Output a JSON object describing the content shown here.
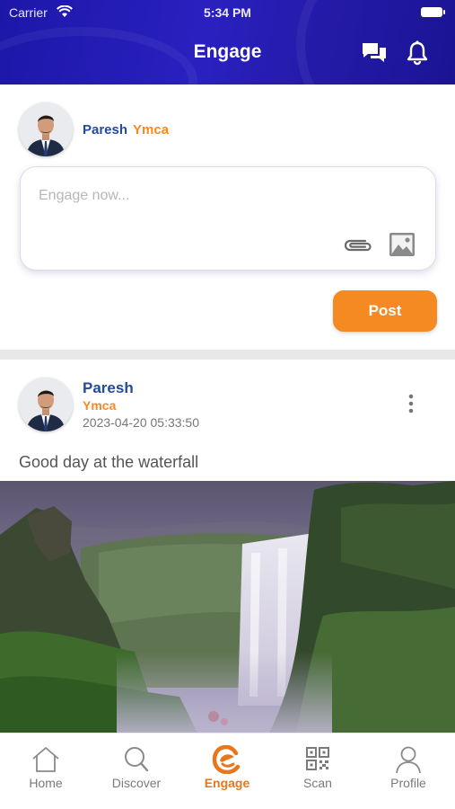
{
  "status_bar": {
    "carrier": "Carrier",
    "time": "5:34 PM"
  },
  "header": {
    "title": "Engage",
    "icons": [
      "chat-icon",
      "bell-icon"
    ]
  },
  "composer": {
    "user_name": "Paresh",
    "user_org": "Ymca",
    "placeholder": "Engage now...",
    "post_label": "Post",
    "icons": [
      "paperclip-icon",
      "image-icon"
    ]
  },
  "post": {
    "author": "Paresh",
    "org": "Ymca",
    "timestamp": "2023-04-20 05:33:50",
    "text": "Good day at the waterfall",
    "icons": [
      "more-vertical-icon"
    ]
  },
  "nav": {
    "items": [
      {
        "label": "Home",
        "icon": "home-icon"
      },
      {
        "label": "Discover",
        "icon": "search-icon"
      },
      {
        "label": "Engage",
        "icon": "engage-logo-icon"
      },
      {
        "label": "Scan",
        "icon": "qr-code-icon"
      },
      {
        "label": "Profile",
        "icon": "person-icon"
      }
    ],
    "active": "Engage"
  },
  "colors": {
    "header": "#2a20c0",
    "accent": "#f58a23",
    "name": "#244a9c"
  }
}
